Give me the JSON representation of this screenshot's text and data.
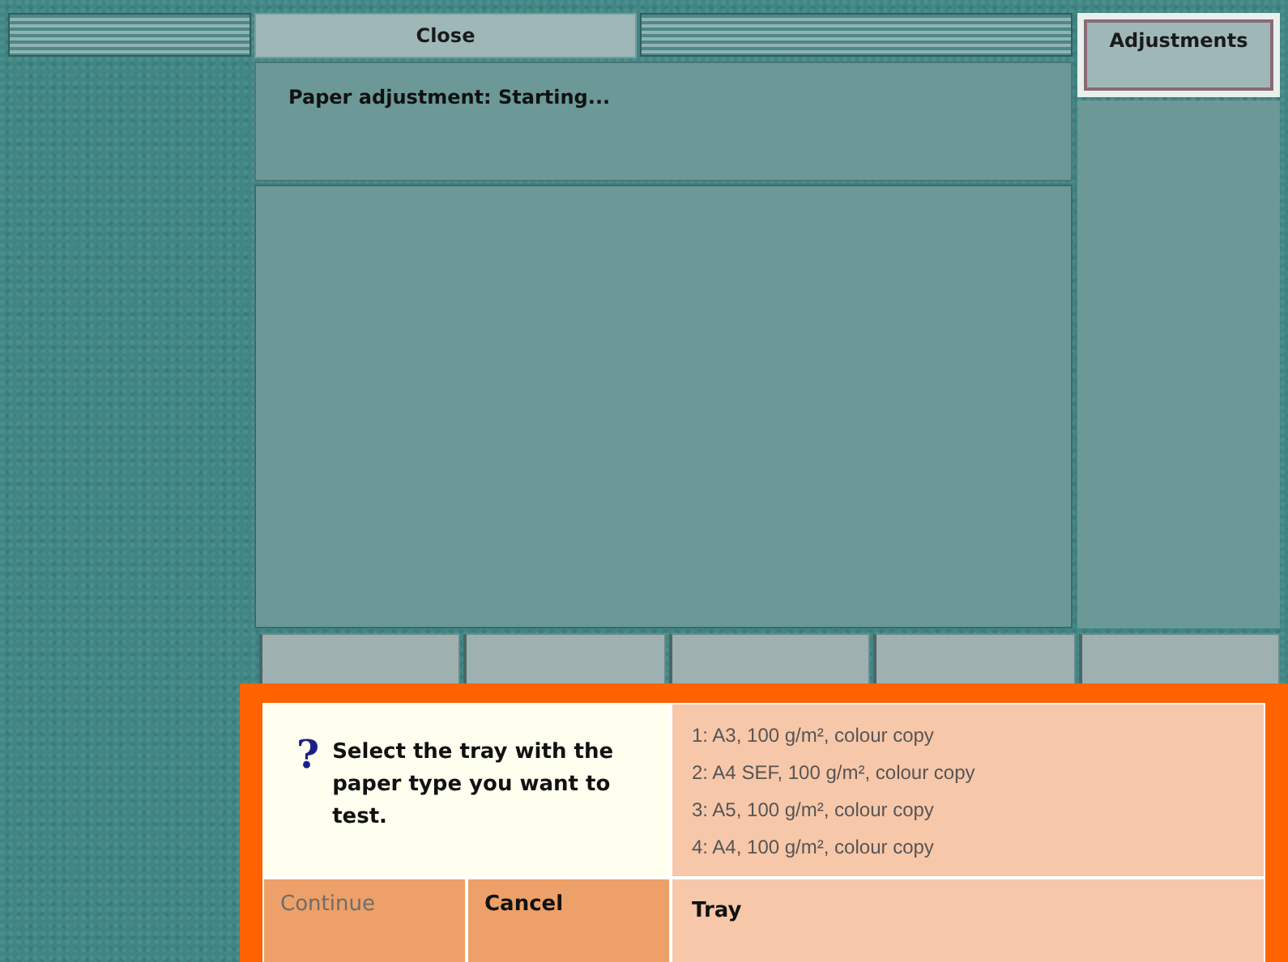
{
  "header": {
    "close_button": "Close"
  },
  "side_tab": {
    "label": "Adjustments",
    "selected": true
  },
  "status_message": "Paper adjustment: Starting...",
  "dialog": {
    "icon": "?",
    "message": "Select the tray with the paper type you want to test.",
    "trays": [
      "1: A3, 100 g/m², colour copy",
      "2: A4 SEF, 100 g/m², colour copy",
      "3: A5, 100 g/m², colour copy",
      "4: A4, 100 g/m², colour copy"
    ],
    "buttons": [
      {
        "label": "Continue",
        "disabled": true
      },
      {
        "label": "Cancel",
        "disabled": false
      }
    ],
    "field_label": "Tray"
  }
}
